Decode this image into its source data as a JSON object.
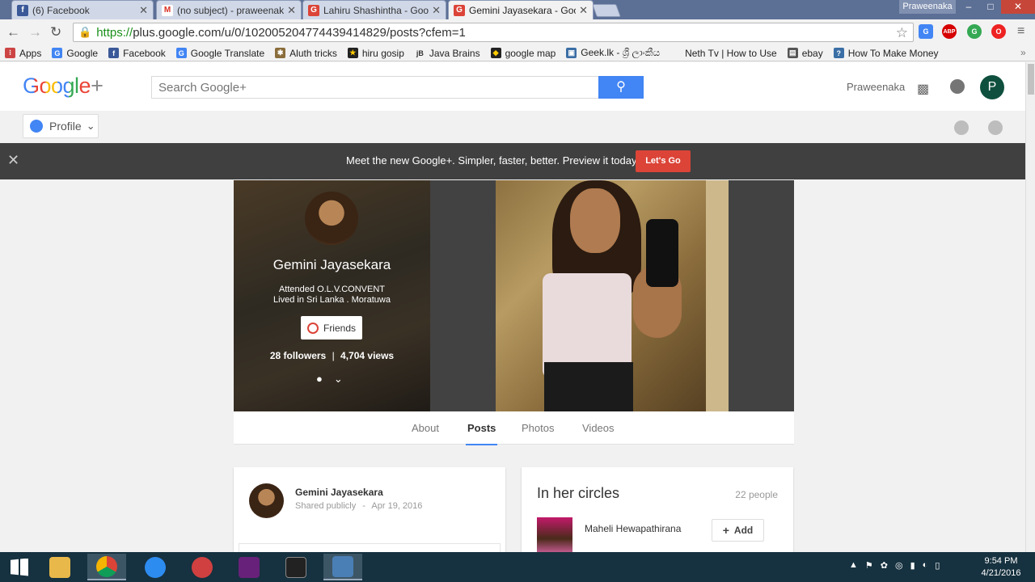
{
  "tabs": [
    {
      "title": "(6) Facebook",
      "icon": "facebook-icon",
      "color": "#3b5998",
      "glyph": "f"
    },
    {
      "title": "(no subject) - praweenaka",
      "icon": "gmail-icon",
      "color": "#d93025",
      "glyph": "M"
    },
    {
      "title": "Lahiru Shashintha - Goog",
      "icon": "gplus-icon",
      "color": "#db4437",
      "glyph": "G"
    },
    {
      "title": "Gemini Jayasekara - Goog",
      "icon": "gplus-icon",
      "color": "#db4437",
      "glyph": "G"
    }
  ],
  "window": {
    "user": "Praweenaka",
    "minimize": "–",
    "maximize": "□",
    "close": "✕"
  },
  "toolbar": {
    "url_protocol": "https://",
    "url_rest": "plus.google.com/u/0/102005204774439414829/posts?cfem=1",
    "star": "☆"
  },
  "extensions": [
    {
      "name": "translate-ext-icon",
      "label": "G",
      "color": "#4285f4"
    },
    {
      "name": "adblock-ext-icon",
      "label": "ABP",
      "color": "#d60000"
    },
    {
      "name": "green-ext-icon",
      "label": "G",
      "color": "#34a853"
    },
    {
      "name": "opera-ext-icon",
      "label": "O",
      "color": "#e22"
    }
  ],
  "bookmarks": [
    {
      "label": "Apps",
      "icon": "apps-icon",
      "color": "#c44"
    },
    {
      "label": "Google",
      "icon": "google-icon",
      "color": "#4285f4"
    },
    {
      "label": "Facebook",
      "icon": "facebook-icon",
      "color": "#3b5998"
    },
    {
      "label": "Google Translate",
      "icon": "translate-icon",
      "color": "#4285f4"
    },
    {
      "label": "Aluth tricks",
      "icon": "tricks-icon",
      "color": "#8a6d3b"
    },
    {
      "label": "hiru gosip",
      "icon": "hiru-icon",
      "color": "#222"
    },
    {
      "label": "Java Brains",
      "icon": "java-brains-icon",
      "color": "#555"
    },
    {
      "label": "google map",
      "icon": "map-icon",
      "color": "#222"
    },
    {
      "label": "Geek.lk - ශ්‍රී ලාංකීය",
      "icon": "geek-icon",
      "color": "#3a6ea5"
    },
    {
      "label": "Neth Tv | How to Use",
      "icon": "neth-icon",
      "color": "#f2f2f2"
    },
    {
      "label": "ebay",
      "icon": "ebay-icon",
      "color": "#555"
    },
    {
      "label": "How To Make Money",
      "icon": "money-icon",
      "color": "#3a6ea5"
    }
  ],
  "header": {
    "logo_google": "Google",
    "logo_plus": "+",
    "search_placeholder": "Search Google+",
    "search_icon": "search-icon",
    "user": "Praweenaka",
    "apps_icon": "⋮⋮⋮",
    "avatar_letter": "P"
  },
  "subbar": {
    "profile_label": "Profile",
    "chevron": "⌄"
  },
  "banner": {
    "close": "✕",
    "message": "Meet the new Google+.   Simpler, faster, better. Preview it today.",
    "button": "Let's Go"
  },
  "profile": {
    "name": "Gemini Jayasekara",
    "attended": "Attended O.L.V.CONVENT",
    "lived": "Lived in Sri Lanka . Moratuwa",
    "friends_label": "Friends",
    "followers": "28 followers",
    "views": "4,704 views",
    "separator": "|",
    "pin": "●",
    "more": "⌄"
  },
  "profile_tabs": [
    "About",
    "Posts",
    "Photos",
    "Videos"
  ],
  "post": {
    "author": "Gemini Jayasekara",
    "visibility": "Shared publicly",
    "dot": "-",
    "date": "Apr 19, 2016"
  },
  "circles": {
    "title": "In her circles",
    "count": "22 people",
    "person": "Maheli Hewapathirana",
    "add": "Add",
    "add_icon": "+"
  },
  "taskbar": {
    "apps": [
      {
        "name": "start-button",
        "color": "#ffffff"
      },
      {
        "name": "file-explorer-icon",
        "color": "#e8b84a"
      },
      {
        "name": "chrome-icon",
        "color": "#e5e5e5"
      },
      {
        "name": "skype-like-icon",
        "color": "#2d8cf0"
      },
      {
        "name": "snipping-tool-icon",
        "color": "#d04040"
      },
      {
        "name": "visual-studio-icon",
        "color": "#68217a"
      },
      {
        "name": "mysql-icon",
        "color": "#222222"
      },
      {
        "name": "virtualbox-icon",
        "color": "#4a7fb5"
      }
    ],
    "time": "9:54 PM",
    "date": "4/21/2016"
  }
}
